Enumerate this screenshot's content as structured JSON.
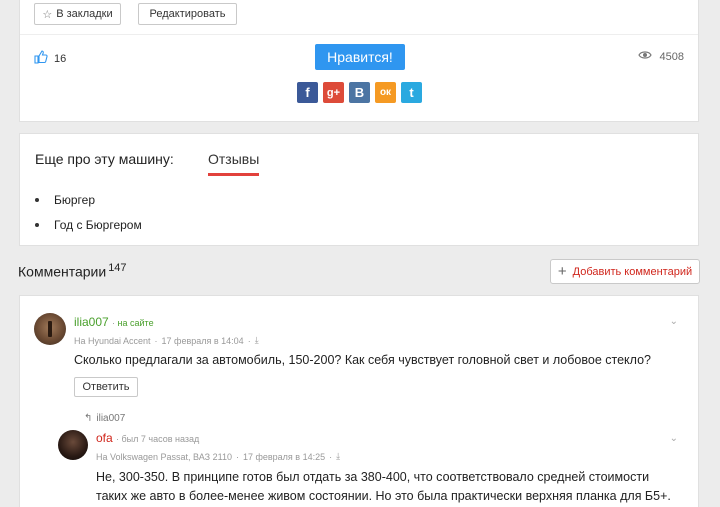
{
  "toolbar": {
    "bookmark_label": "В закладки",
    "edit_label": "Редактировать"
  },
  "likes": {
    "count": "16",
    "button_label": "Нравится!"
  },
  "views": {
    "count": "4508"
  },
  "share": [
    {
      "name": "facebook",
      "glyph": "f",
      "color": "#3b5998"
    },
    {
      "name": "google-plus",
      "glyph": "g+",
      "color": "#dd4b39"
    },
    {
      "name": "vkontakte",
      "glyph": "B",
      "color": "#4c75a3"
    },
    {
      "name": "odnoklassniki",
      "glyph": "ок",
      "color": "#f59a23"
    },
    {
      "name": "twitter",
      "glyph": "t",
      "color": "#2aa9e0"
    }
  ],
  "more": {
    "title": "Еще про эту машину:",
    "tab": "Отзывы",
    "links": [
      "Бюргер",
      "Год с Бюргером"
    ]
  },
  "comments": {
    "title": "Комментарии",
    "count": "147",
    "add_label": "Добавить комментарий",
    "items": [
      {
        "user": "ilia007",
        "status": "на сайте",
        "car": "На Hyundai Accent",
        "date": "17 февраля в 14:04",
        "text": "Сколько предлагали за автомобиль, 150-200? Как себя чувствует головной свет и лобовое стекло?",
        "reply_label": "Ответить"
      },
      {
        "reply_to": "ilia007",
        "user": "ofa",
        "status": "был 7 часов назад",
        "car": "На Volkswagen Passat, ВАЗ 2110",
        "date": "17 февраля в 14:25",
        "text_line1": "Не, 300-350. В принципе готов был отдать за 380-400, что соответствовало средней стоимости",
        "text_line2": "таких же авто в более-менее живом состоянии. Но это была практически верхняя планка для Б5+."
      }
    ]
  },
  "colors": {
    "accent_blue": "#2f96f0",
    "username_green": "#4aa02c",
    "username_red": "#d0261c",
    "tab_underline": "#e2413c"
  }
}
